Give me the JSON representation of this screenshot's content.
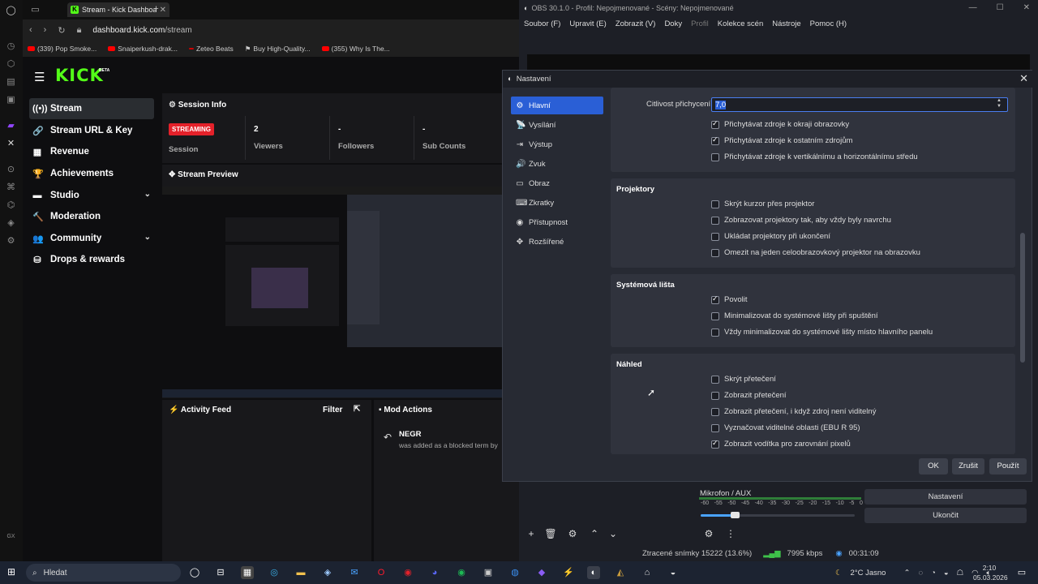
{
  "browser": {
    "tab_title": "Stream - Kick Dashboard",
    "url_host": "dashboard.kick.com",
    "url_path": "/stream",
    "bookmarks": [
      "(339) Pop Smoke...",
      "Snaiperkush-drak...",
      "Zeteo Beats",
      "Buy High-Quality...",
      "(355) Why Is The..."
    ]
  },
  "kick": {
    "logo": "KICK",
    "beta": "BETA",
    "nav": [
      {
        "label": "Stream",
        "icon": "((•))"
      },
      {
        "label": "Stream URL & Key",
        "icon": "🔗"
      },
      {
        "label": "Revenue",
        "icon": "▦"
      },
      {
        "label": "Achievements",
        "icon": "🏆"
      },
      {
        "label": "Studio",
        "icon": "▬"
      },
      {
        "label": "Moderation",
        "icon": "🔨"
      },
      {
        "label": "Community",
        "icon": "👥"
      },
      {
        "label": "Drops & rewards",
        "icon": "⛁"
      }
    ],
    "session": {
      "title": "Session Info",
      "status_badge": "STREAMING",
      "session_label": "Session",
      "viewers_value": "2",
      "viewers_label": "Viewers",
      "followers_value": "-",
      "followers_label": "Followers",
      "subs_value": "-",
      "subs_label": "Sub Counts"
    },
    "preview_title": "Stream Preview",
    "activity": {
      "title": "Activity Feed",
      "filter": "Filter"
    },
    "mod_actions": {
      "title": "Mod Actions",
      "user": "NEGR",
      "message": "was added as a blocked term by"
    }
  },
  "obs": {
    "title": "OBS 30.1.0 - Profil: Nepojmenované - Scény: Nepojmenované",
    "menu": [
      "Soubor (F)",
      "Upravit (E)",
      "Zobrazit (V)",
      "Doky",
      "Profil",
      "Kolekce scén",
      "Nástroje",
      "Pomoc (H)"
    ],
    "mixer_label": "Mikrofon / AUX",
    "meter_ticks": [
      "-60",
      "-55",
      "-50",
      "-45",
      "-40",
      "-35",
      "-30",
      "-25",
      "-20",
      "-15",
      "-10",
      "-5",
      "0"
    ],
    "volume_fraction": 0.22,
    "side_buttons": {
      "settings": "Nastavení",
      "exit": "Ukončit"
    },
    "status": {
      "dropped": "Ztracené snímky 15222 (13.6%)",
      "bitrate": "7995 kbps",
      "time": "00:31:09"
    }
  },
  "settings": {
    "title": "Nastavení",
    "sidebar": [
      {
        "label": "Hlavní",
        "icon": "⚙"
      },
      {
        "label": "Vysílání",
        "icon": "📡"
      },
      {
        "label": "Výstup",
        "icon": "⇥"
      },
      {
        "label": "Zvuk",
        "icon": "🔊"
      },
      {
        "label": "Obraz",
        "icon": "▭"
      },
      {
        "label": "Zkratky",
        "icon": "⌨"
      },
      {
        "label": "Přístupnost",
        "icon": "◉"
      },
      {
        "label": "Rozšířené",
        "icon": "✥"
      }
    ],
    "snap_label": "Citlivost přichycení",
    "snap_value": "7,0",
    "snap_checks": [
      {
        "label": "Přichytávat zdroje k okraji obrazovky",
        "checked": true
      },
      {
        "label": "Přichytávat zdroje k ostatním zdrojům",
        "checked": true
      },
      {
        "label": "Přichytávat zdroje k vertikálnímu a horizontálnímu středu",
        "checked": false
      }
    ],
    "projectors": {
      "title": "Projektory",
      "items": [
        {
          "label": "Skrýt kurzor přes projektor",
          "checked": false
        },
        {
          "label": "Zobrazovat projektory tak, aby vždy byly navrchu",
          "checked": false
        },
        {
          "label": "Ukládat projektory při ukončení",
          "checked": false
        },
        {
          "label": "Omezit na jeden celoobrazovkový projektor na obrazovku",
          "checked": false
        }
      ]
    },
    "tray": {
      "title": "Systémová lišta",
      "items": [
        {
          "label": "Povolit",
          "checked": true
        },
        {
          "label": "Minimalizovat do systémové lišty při spuštění",
          "checked": false
        },
        {
          "label": "Vždy minimalizovat do systémové lišty místo hlavního panelu",
          "checked": false
        }
      ]
    },
    "preview": {
      "title": "Náhled",
      "items": [
        {
          "label": "Skrýt přetečení",
          "checked": false
        },
        {
          "label": "Zobrazit přetečení",
          "checked": false
        },
        {
          "label": "Zobrazit přetečení, i když zdroj není viditelný",
          "checked": false
        },
        {
          "label": "Vyznačovat viditelné oblasti (EBU R 95)",
          "checked": false
        },
        {
          "label": "Zobrazit vodítka pro zarovnání pixelů",
          "checked": true
        }
      ]
    },
    "buttons": {
      "ok": "OK",
      "cancel": "Zrušit",
      "apply": "Použít"
    }
  },
  "taskbar": {
    "search_placeholder": "Hledat",
    "weather": "2°C  Jasno",
    "time": "2:10",
    "date": "05.03.2026"
  }
}
